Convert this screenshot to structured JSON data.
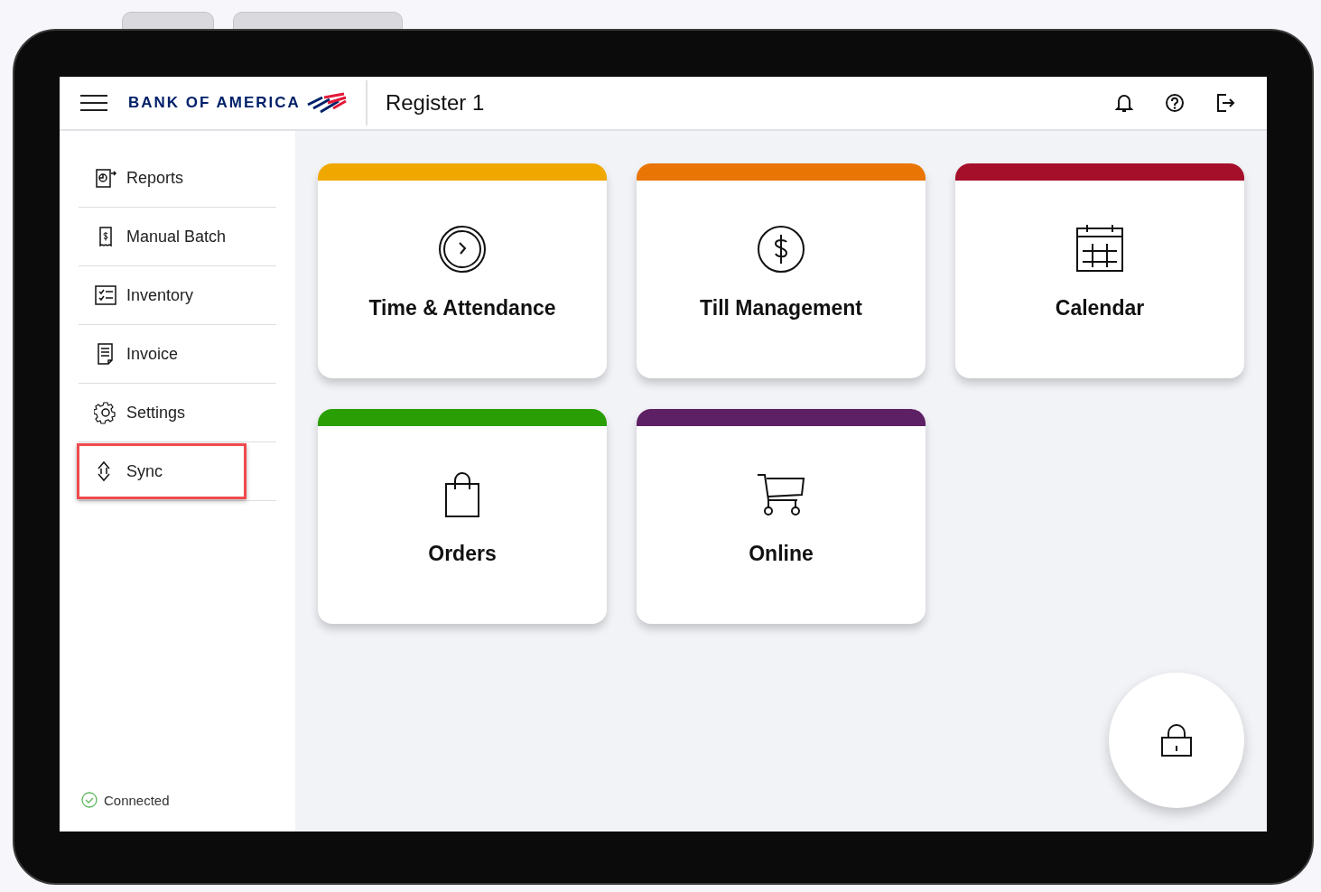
{
  "header": {
    "brand": "BANK OF AMERICA",
    "title": "Register 1"
  },
  "sidebar": {
    "items": [
      {
        "label": "Reports",
        "kind": "reports",
        "highlighted": false
      },
      {
        "label": "Manual Batch",
        "kind": "batch",
        "highlighted": false
      },
      {
        "label": "Inventory",
        "kind": "inventory",
        "highlighted": false
      },
      {
        "label": "Invoice",
        "kind": "invoice",
        "highlighted": false
      },
      {
        "label": "Settings",
        "kind": "settings",
        "highlighted": false
      },
      {
        "label": "Sync",
        "kind": "sync",
        "highlighted": true
      }
    ],
    "status": {
      "label": "Connected",
      "connected": true
    }
  },
  "tiles": [
    {
      "label": "Time & Attendance",
      "kind": "clock",
      "color": "#f0a800"
    },
    {
      "label": "Till Management",
      "kind": "dollar",
      "color": "#e97505"
    },
    {
      "label": "Calendar",
      "kind": "calendar",
      "color": "#a50f2a"
    },
    {
      "label": "Orders",
      "kind": "bag",
      "color": "#2a9e05"
    },
    {
      "label": "Online",
      "kind": "cart",
      "color": "#5e2064"
    }
  ]
}
